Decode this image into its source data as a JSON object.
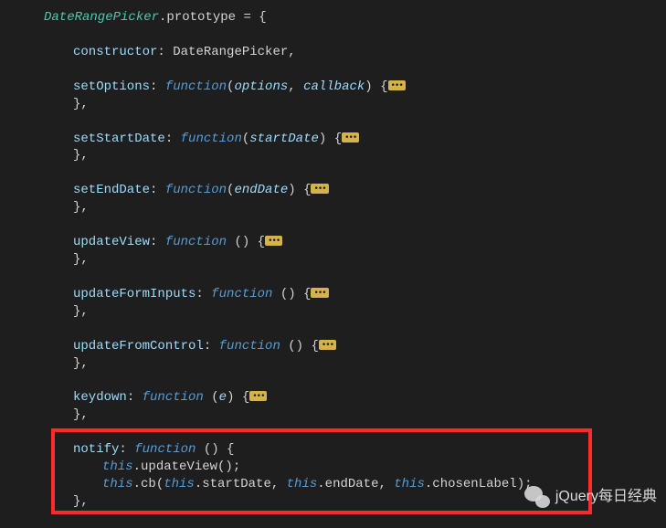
{
  "code": {
    "className": "DateRangePicker",
    "prototypeKw": ".prototype",
    "equals": " = {",
    "constructorProp": "constructor",
    "constructorRef": "DateRangePicker",
    "methods": {
      "setOptions": {
        "name": "setOptions",
        "params": [
          "options",
          "callback"
        ]
      },
      "setStartDate": {
        "name": "setStartDate",
        "params": [
          "startDate"
        ]
      },
      "setEndDate": {
        "name": "setEndDate",
        "params": [
          "endDate"
        ]
      },
      "updateView": {
        "name": "updateView",
        "params": []
      },
      "updateFormInputs": {
        "name": "updateFormInputs",
        "params": []
      },
      "updateFromControl": {
        "name": "updateFromControl",
        "params": []
      },
      "keydown": {
        "name": "keydown",
        "params": [
          "e"
        ]
      },
      "notify": {
        "name": "notify",
        "params": []
      }
    },
    "functionKw": "function",
    "thisKw": "this",
    "foldGlyph": "•••",
    "closeBrace": "},",
    "notifyBody": {
      "line1a": ".updateView();",
      "line2a": ".cb(",
      "line2b": ".startDate, ",
      "line2c": ".endDate, ",
      "line2d": ".chosenLabel);"
    }
  },
  "watermark": "jQuery每日经典"
}
